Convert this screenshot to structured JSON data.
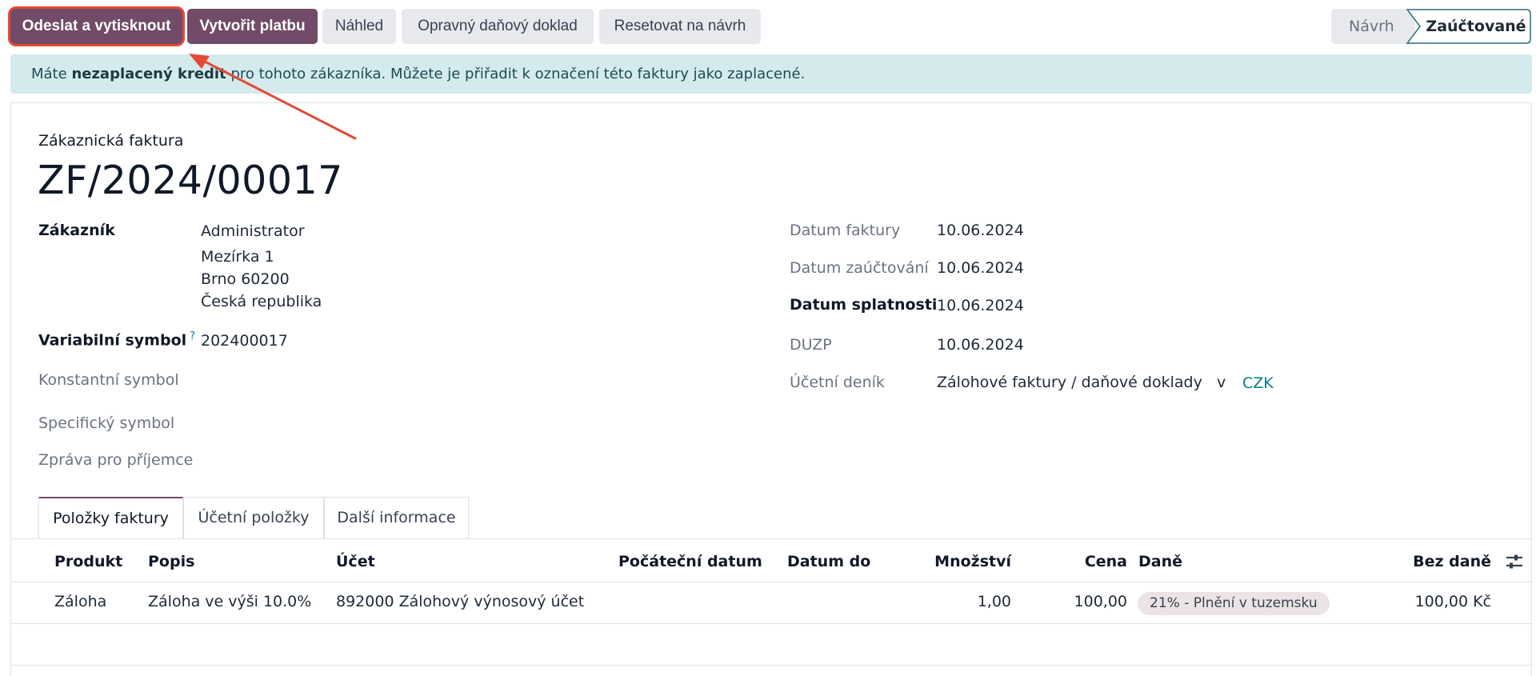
{
  "toolbar": {
    "send_print": "Odeslat a vytisknout",
    "register_payment": "Vytvořit platbu",
    "preview": "Náhled",
    "credit_note": "Opravný daňový doklad",
    "reset_draft": "Resetovat na návrh"
  },
  "status": {
    "draft": "Návrh",
    "posted": "Zaúčtované",
    "current": "posted"
  },
  "alert": {
    "prefix": "Máte",
    "emphasis": "nezaplacený kredit",
    "suffix": "pro tohoto zákazníka. Můžete je přiřadit k označení této faktury jako zaplacené."
  },
  "invoice": {
    "doc_type": "Zákaznická faktura",
    "number": "ZF/2024/00017"
  },
  "left_fields": {
    "customer_label": "Zákazník",
    "customer_name": "Administrator",
    "customer_street": "Mezírka 1",
    "customer_city": "Brno 60200",
    "customer_country": "Česká republika",
    "variable_symbol_label": "Variabilní symbol",
    "variable_symbol_help": "?",
    "variable_symbol": "202400017",
    "constant_symbol_label": "Konstantní symbol",
    "specific_symbol_label": "Specifický symbol",
    "message_label": "Zpráva pro příjemce"
  },
  "right_fields": {
    "invoice_date_label": "Datum faktury",
    "invoice_date": "10.06.2024",
    "accounting_date_label": "Datum zaúčtování",
    "accounting_date": "10.06.2024",
    "due_date_label": "Datum splatnosti",
    "due_date": "10.06.2024",
    "duzp_label": "DUZP",
    "duzp": "10.06.2024",
    "journal_label": "Účetní deník",
    "journal": "Zálohové faktury / daňové doklady",
    "journal_in": "v",
    "currency": "CZK"
  },
  "tabs": [
    {
      "label": "Položky faktury",
      "active": true
    },
    {
      "label": "Účetní položky",
      "active": false
    },
    {
      "label": "Další informace",
      "active": false
    }
  ],
  "table": {
    "headers": {
      "product": "Produkt",
      "description": "Popis",
      "account": "Účet",
      "start_date": "Počáteční datum",
      "end_date": "Datum do",
      "quantity": "Množství",
      "price": "Cena",
      "taxes": "Daně",
      "subtotal": "Bez daně"
    },
    "rows": [
      {
        "product": "Záloha",
        "description": "Záloha ve výši 10.0%",
        "account": "892000 Zálohový výnosový účet",
        "start_date": "",
        "end_date": "",
        "quantity": "1,00",
        "price": "100,00",
        "tax": "21% - Plnění v tuzemsku",
        "subtotal": "100,00 Kč"
      }
    ]
  },
  "colors": {
    "primary": "#714b67",
    "secondary_btn": "#e7e9ed",
    "alert_bg": "#d4eaed",
    "link": "#017e84",
    "annotation": "#e34a33"
  }
}
